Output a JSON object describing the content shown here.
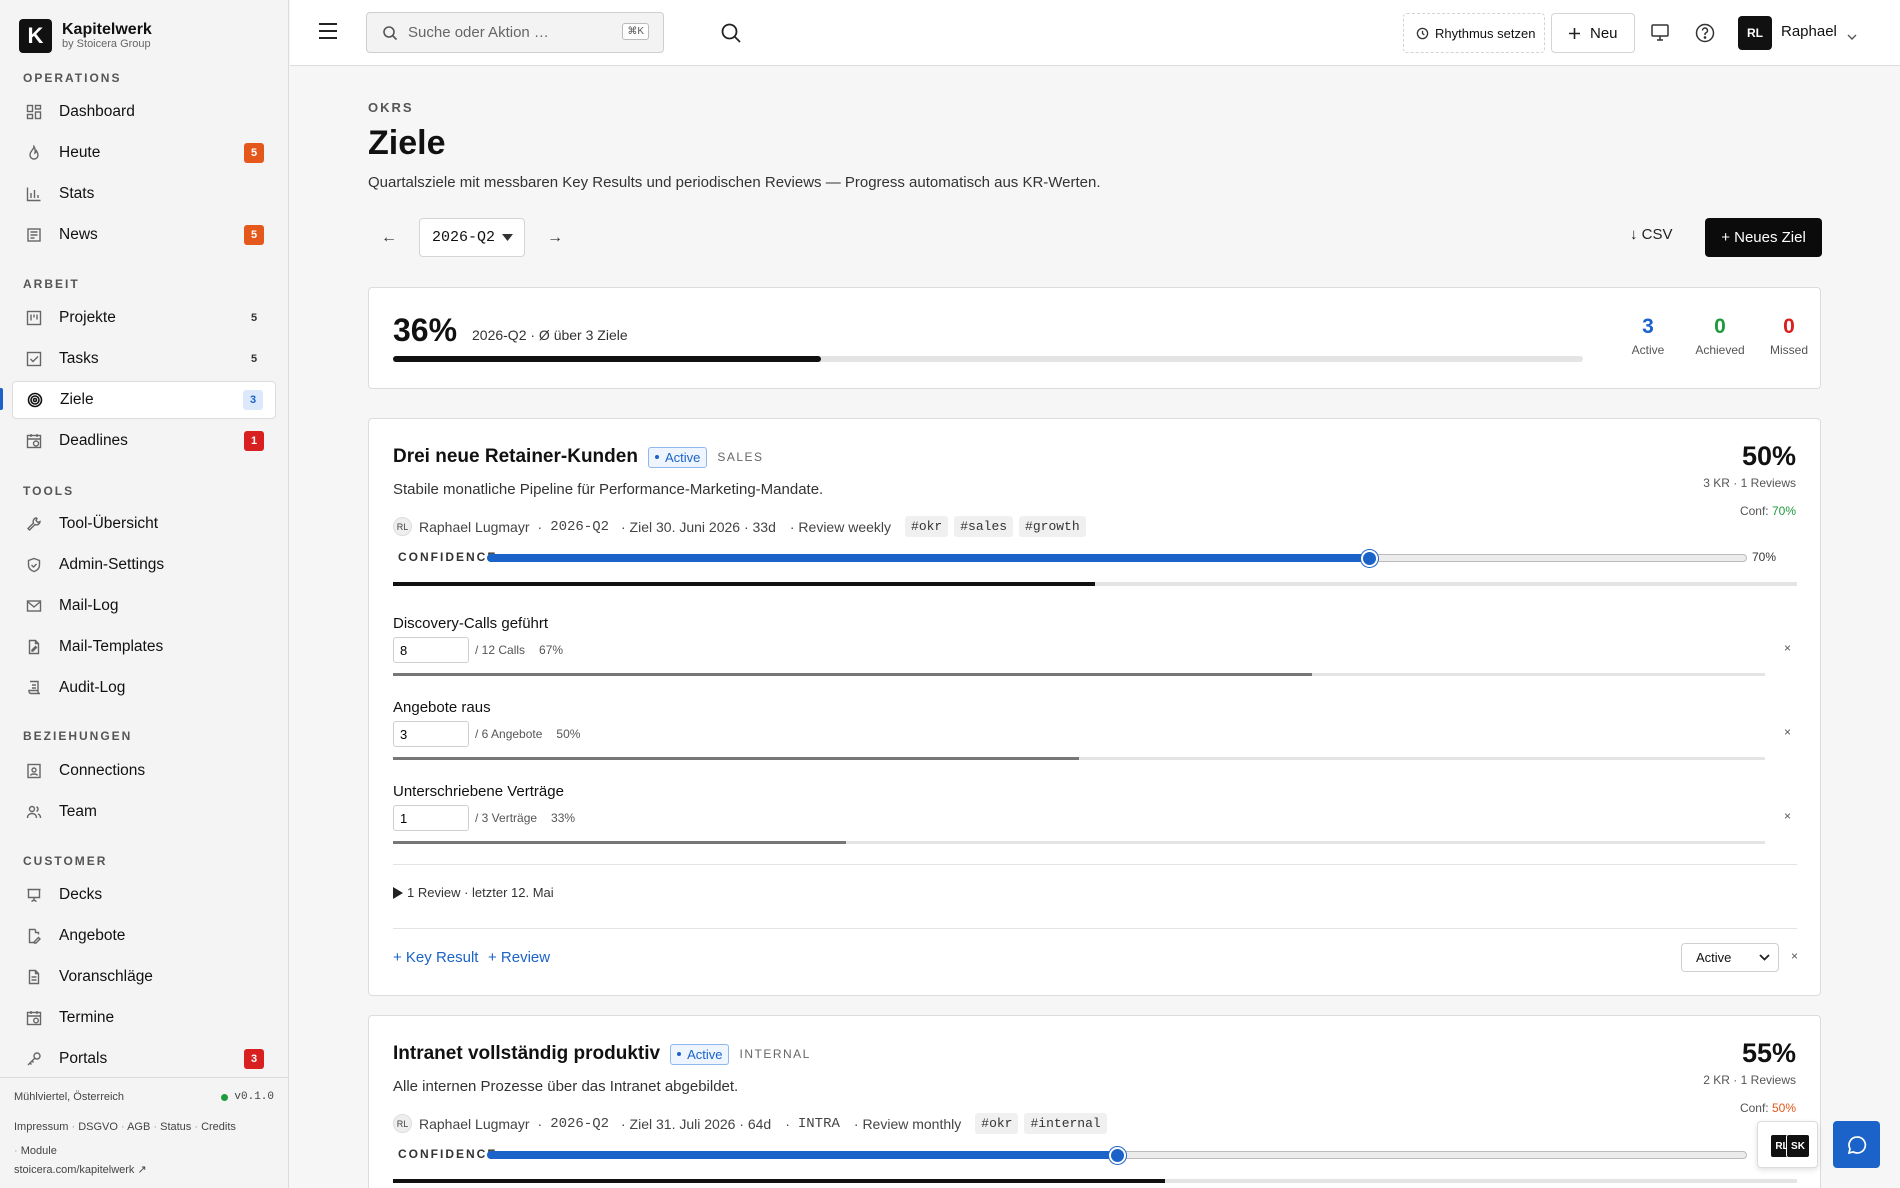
{
  "brand": {
    "name": "Kapitelwerk",
    "sub": "by Stoicera Group",
    "logo_letter": "K"
  },
  "sidebar": {
    "sections": [
      {
        "title": "OPERATIONS"
      },
      {
        "title": "ARBEIT"
      },
      {
        "title": "TOOLS"
      },
      {
        "title": "BEZIEHUNGEN"
      },
      {
        "title": "CUSTOMER"
      }
    ],
    "items": [
      {
        "label": "Dashboard",
        "icon": "dashboard-icon"
      },
      {
        "label": "Heute",
        "badge": "5",
        "icon": "flame-icon"
      },
      {
        "label": "Stats",
        "icon": "bar-chart-icon"
      },
      {
        "label": "News",
        "badge": "5",
        "icon": "newspaper-icon"
      },
      {
        "label": "Projekte",
        "badge": "5",
        "icon": "kanban-icon"
      },
      {
        "label": "Tasks",
        "badge": "5",
        "icon": "checkbox-icon"
      },
      {
        "label": "Ziele",
        "badge": "3",
        "icon": "target-icon"
      },
      {
        "label": "Deadlines",
        "badge": "1",
        "icon": "calendar-clock-icon"
      },
      {
        "label": "Tool-Übersicht",
        "icon": "wrench-icon"
      },
      {
        "label": "Admin-Settings",
        "icon": "shield-icon"
      },
      {
        "label": "Mail-Log",
        "icon": "mail-icon"
      },
      {
        "label": "Mail-Templates",
        "icon": "file-edit-icon"
      },
      {
        "label": "Audit-Log",
        "icon": "scroll-icon"
      },
      {
        "label": "Connections",
        "icon": "contact-icon"
      },
      {
        "label": "Team",
        "icon": "users-icon"
      },
      {
        "label": "Decks",
        "icon": "presentation-icon"
      },
      {
        "label": "Angebote",
        "icon": "file-pen-icon"
      },
      {
        "label": "Voranschläge",
        "icon": "file-text-icon"
      },
      {
        "label": "Termine",
        "icon": "calendar-icon"
      },
      {
        "label": "Portals",
        "badge": "3",
        "icon": "key-icon"
      }
    ],
    "footer": {
      "location": "Mühlviertel, Österreich",
      "version": "v0.1.0",
      "links": [
        "Impressum",
        "DSGVO",
        "AGB",
        "Status",
        "Credits",
        "Module"
      ],
      "site": "stoicera.com/kapitelwerk ↗"
    }
  },
  "topbar": {
    "search_placeholder": "Suche oder Aktion …",
    "search_shortcut": "⌘K",
    "rhythm_label": "Rhythmus setzen",
    "new_label": "Neu",
    "user_initials": "RL",
    "user_name": "Raphael"
  },
  "page": {
    "eyebrow": "OKRS",
    "title": "Ziele",
    "subtitle": "Quartalsziele mit messbaren Key Results und periodischen Reviews — Progress automatisch aus KR-Werten.",
    "period": "2026-Q2",
    "prev": "←",
    "next": "→",
    "csv_label": "↓ CSV",
    "new_goal_label": "+ Neues Ziel"
  },
  "summary": {
    "percent": "36%",
    "percent_value": 36,
    "caption": "2026-Q2 · Ø über 3 Ziele",
    "stats": [
      {
        "value": "3",
        "label": "Active",
        "color": "#1b63c8"
      },
      {
        "value": "0",
        "label": "Achieved",
        "color": "#1f9a3e"
      },
      {
        "value": "0",
        "label": "Missed",
        "color": "#d92020"
      }
    ]
  },
  "goals": [
    {
      "title": "Drei neue Retainer-Kunden",
      "status": "Active",
      "category": "SALES",
      "description": "Stabile monatliche Pipeline für Performance-Marketing-Mandate.",
      "owner_initials": "RL",
      "owner": "Raphael Lugmayr",
      "period": "2026-Q2",
      "deadline": "· Ziel 30. Juni 2026 · 33d",
      "review": "· Review weekly",
      "tags": [
        "#okr",
        "#sales",
        "#growth"
      ],
      "percent": "50%",
      "progress": 50,
      "meta": "3 KR · 1 Reviews",
      "conf_label": "Conf:",
      "conf_value": "70%",
      "confidence": 70,
      "confidence_label": "CONFIDENCE",
      "key_results": [
        {
          "title": "Discovery-Calls geführt",
          "value": "8",
          "target": "/ 12 Calls",
          "pct": "67%",
          "progress": 67
        },
        {
          "title": "Angebote raus",
          "value": "3",
          "target": "/ 6 Angebote",
          "pct": "50%",
          "progress": 50
        },
        {
          "title": "Unterschriebene Verträge",
          "value": "1",
          "target": "/ 3 Verträge",
          "pct": "33%",
          "progress": 33
        }
      ],
      "reviews_summary": "1 Review · letzter 12. Mai",
      "add_kr": "+ Key Result",
      "add_review": "+ Review",
      "status_select": "Active"
    },
    {
      "title": "Intranet vollständig produktiv",
      "status": "Active",
      "category": "INTERNAL",
      "description": "Alle internen Prozesse über das Intranet abgebildet.",
      "owner_initials": "RL",
      "owner": "Raphael Lugmayr",
      "period": "2026-Q2",
      "deadline": "· Ziel 31. Juli 2026 · 64d",
      "org": "INTRA",
      "review": "· Review monthly",
      "tags": [
        "#okr",
        "#internal"
      ],
      "percent": "55%",
      "progress": 55,
      "meta": "2 KR · 1 Reviews",
      "conf_label": "Conf:",
      "conf_value": "50%",
      "confidence": 50,
      "confidence_label": "CONFIDENCE"
    }
  ],
  "presence": {
    "a": "RL",
    "b": "SK"
  },
  "colors": {
    "accent": "#1b63c8",
    "orange": "#e4581c",
    "red": "#d92020",
    "green": "#1f9a3e"
  }
}
